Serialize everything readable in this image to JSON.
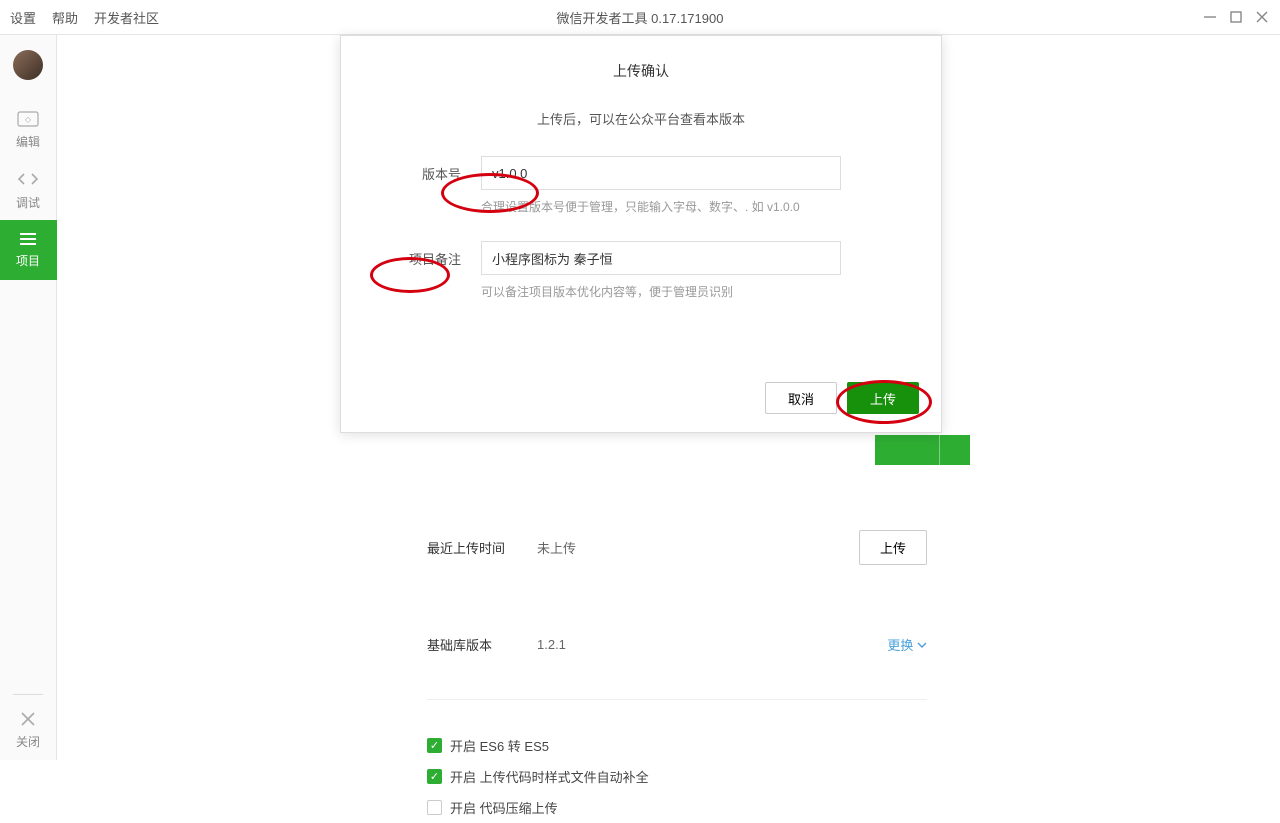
{
  "menubar": {
    "settings": "设置",
    "help": "帮助",
    "community": "开发者社区",
    "title": "微信开发者工具 0.17.171900"
  },
  "sidebar": {
    "edit": "编辑",
    "debug": "调试",
    "project": "项目",
    "close": "关闭"
  },
  "modal": {
    "title": "上传确认",
    "subtitle": "上传后，可以在公众平台查看本版本",
    "version_label": "版本号",
    "version_value": "v1.0.0",
    "version_help": "合理设置版本号便于管理，只能输入字母、数字、. 如 v1.0.0",
    "remark_label": "项目备注",
    "remark_value": "小程序图标为 秦子恒",
    "remark_help": "可以备注项目版本优化内容等，便于管理员识别",
    "cancel": "取消",
    "upload": "上传"
  },
  "behind": {
    "last_upload_label": "最近上传时间",
    "last_upload_value": "未上传",
    "upload_btn": "上传",
    "baselib_label": "基础库版本",
    "baselib_value": "1.2.1",
    "change": "更换",
    "opt1": "开启 ES6 转 ES5",
    "opt2": "开启 上传代码时样式文件自动补全",
    "opt3": "开启 代码压缩上传"
  }
}
